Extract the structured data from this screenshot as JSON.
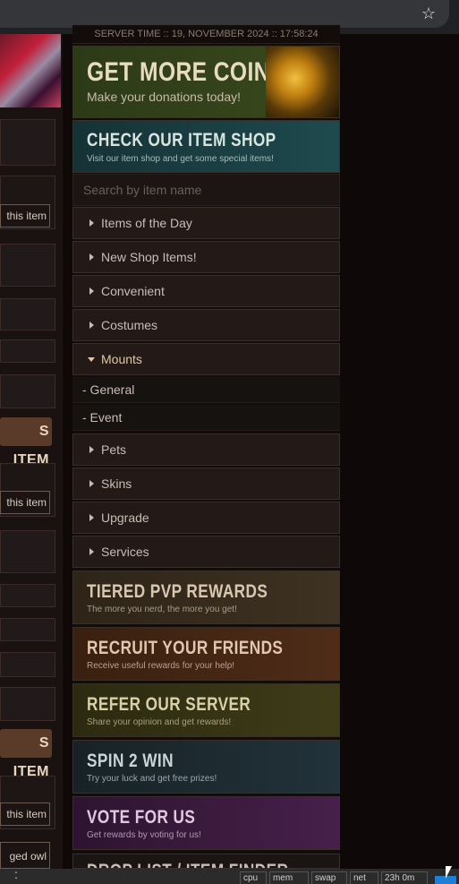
{
  "server_time": "SERVER TIME :: 19, NOVEMBER 2024 :: 17:58:24",
  "left_column": {
    "button_this_item": "this item",
    "big_button_text": "S ITEM",
    "partial_text": "ged owl"
  },
  "promo": {
    "coins_title": "GET MORE COINS",
    "coins_sub": "Make your donations today!",
    "shop_title": "CHECK OUR ITEM SHOP",
    "shop_sub": "Visit our item shop and get some special items!"
  },
  "search": {
    "placeholder": "Search by item name"
  },
  "menu": [
    "Items of the Day",
    "New Shop Items!",
    "Convenient",
    "Costumes",
    "Mounts",
    "Pets",
    "Skins",
    "Upgrade",
    "Services"
  ],
  "mounts_sub": [
    "- General",
    "- Event"
  ],
  "cards": [
    {
      "title": "TIERED PVP REWARDS",
      "sub": "The more you nerd, the more you get!",
      "color": "#3a2e22"
    },
    {
      "title": "RECRUIT YOUR FRIENDS",
      "sub": "Receive useful rewards for your help!",
      "color": "#4a2a18"
    },
    {
      "title": "REFER OUR SERVER",
      "sub": "Share your opinion and get rewards!",
      "color": "#3a3414"
    },
    {
      "title": "SPIN 2 WIN",
      "sub": "Try your luck and get free prizes!",
      "color": "#1e2a30"
    },
    {
      "title": "VOTE FOR US",
      "sub": "Get rewards by voting for us!",
      "color": "#3a1a3a"
    }
  ],
  "bottom_partial_title": "DROP LIST / ITEM FINDER",
  "taskbar": {
    "segments": [
      "cpu",
      "mem",
      "swap",
      "net",
      "23h 0m"
    ]
  }
}
